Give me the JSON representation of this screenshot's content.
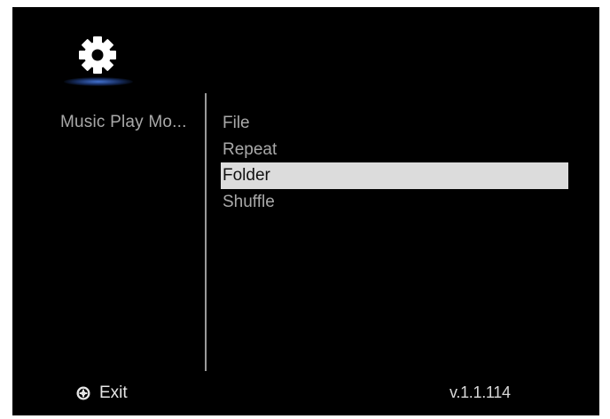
{
  "header": {
    "icon": "gear-icon",
    "accent_glow_color": "#3f6fd0"
  },
  "sidebar": {
    "category_label": "Music Play Mo..."
  },
  "menu": {
    "options": [
      {
        "label": "File"
      },
      {
        "label": "Repeat"
      },
      {
        "label": "Folder"
      },
      {
        "label": "Shuffle"
      }
    ],
    "selected_label": "Folder"
  },
  "footer": {
    "exit_icon": "exit-button-icon",
    "exit_label": "Exit",
    "version": "v.1.1.114"
  },
  "colors": {
    "background": "#000000",
    "text": "#a9a9a9",
    "highlight_bg": "#dcdcdc",
    "highlight_text": "#111111"
  }
}
